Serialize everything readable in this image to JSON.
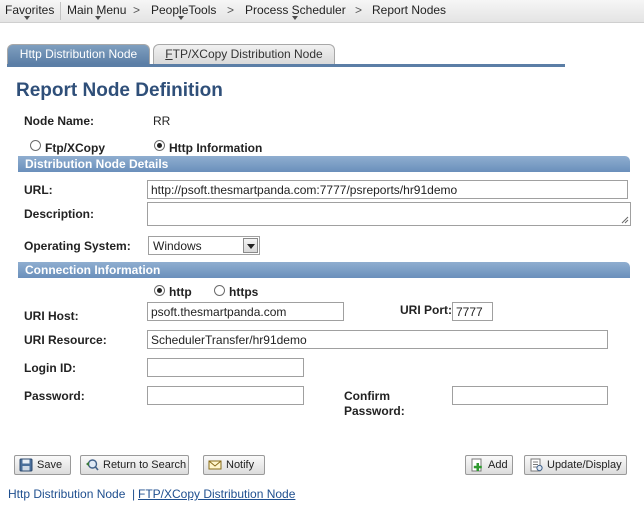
{
  "nav": {
    "favorites": "Favorites",
    "main_menu": "Main Menu",
    "people_tools": "PeopleTools",
    "process_scheduler": "Process Scheduler",
    "report_nodes": "Report Nodes",
    "chevron": ">"
  },
  "tabs": [
    {
      "label": "Http Distribution Node",
      "active": true
    },
    {
      "label_first": "F",
      "label_rest": "TP/XCopy Distribution Node",
      "active": false
    }
  ],
  "page_title": "Report Node Definition",
  "node_name": {
    "label": "Node Name:",
    "value": "RR"
  },
  "node_type": {
    "ftp_label": "Ftp/XCopy",
    "http_label": "Http Information",
    "selected": "Http Information"
  },
  "distribution_section": {
    "title": "Distribution Node Details",
    "url_label": "URL:",
    "url_value": "http://psoft.thesmartpanda.com:7777/psreports/hr91demo",
    "description_label": "Description:",
    "description_value": "",
    "os_label": "Operating System:",
    "os_value": "Windows"
  },
  "connection_section": {
    "title": "Connection Information",
    "protocol_http": "http",
    "protocol_https": "https",
    "protocol_selected": "http",
    "uri_host_label": "URI Host:",
    "uri_host_value": "psoft.thesmartpanda.com",
    "uri_port_label": "URI Port:",
    "uri_port_value": "7777",
    "uri_resource_label": "URI Resource:",
    "uri_resource_value": "SchedulerTransfer/hr91demo",
    "login_id_label": "Login ID:",
    "login_id_value": "",
    "password_label": "Password:",
    "password_value": "",
    "confirm_password_label_1": "Confirm",
    "confirm_password_label_2": "Password:",
    "confirm_password_value": ""
  },
  "buttons": {
    "save": "Save",
    "return_to_search": "Return to Search",
    "notify": "Notify",
    "add": "Add",
    "update_display": "Update/Display"
  },
  "footer": {
    "http_link": "Http Distribution Node",
    "separator": "|",
    "ftp_link": "FTP/XCopy Distribution Node"
  },
  "colors": {
    "accent": "#5b7ea6",
    "title": "#2f4f79",
    "section_bar": "#7a9cc5",
    "link": "#1f4f8f"
  }
}
